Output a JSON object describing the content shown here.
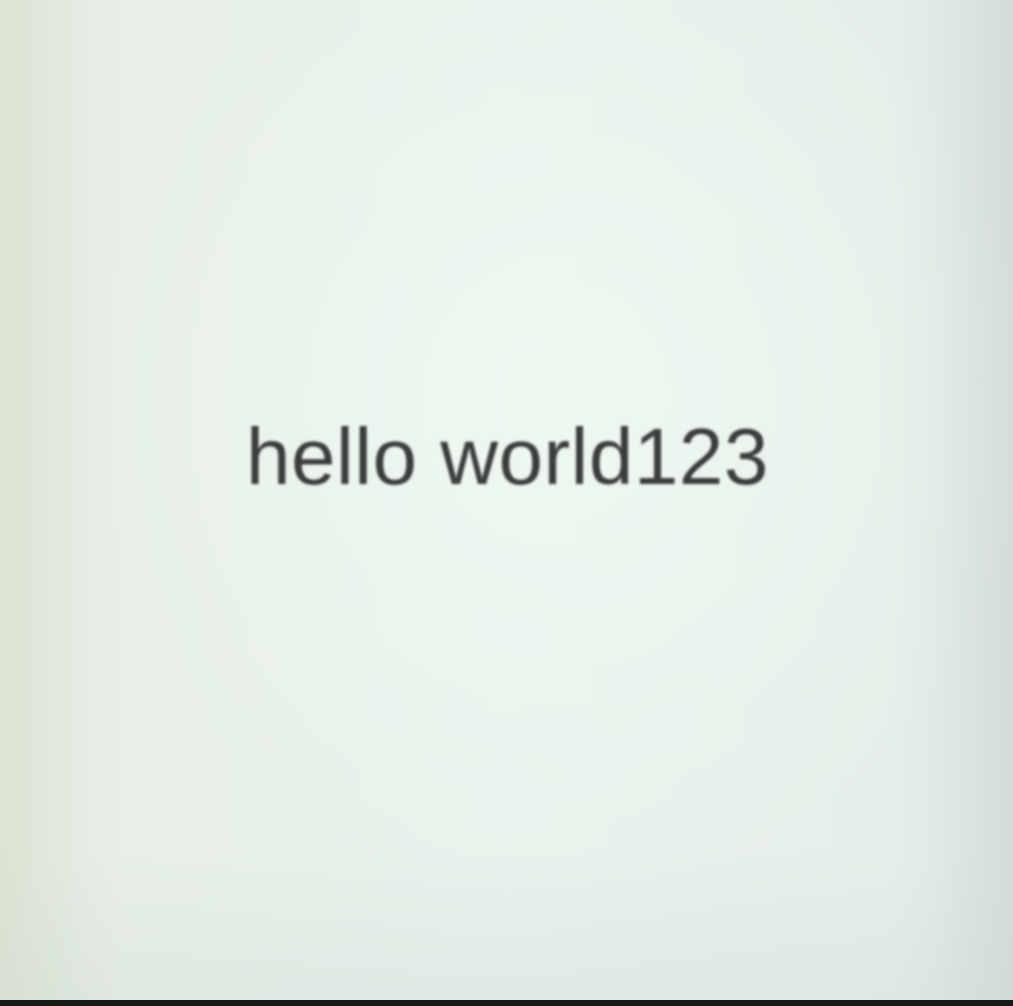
{
  "screen": {
    "text": "hello world123",
    "background_color": "#e8f0eb",
    "text_color": "#3a3d3c"
  }
}
